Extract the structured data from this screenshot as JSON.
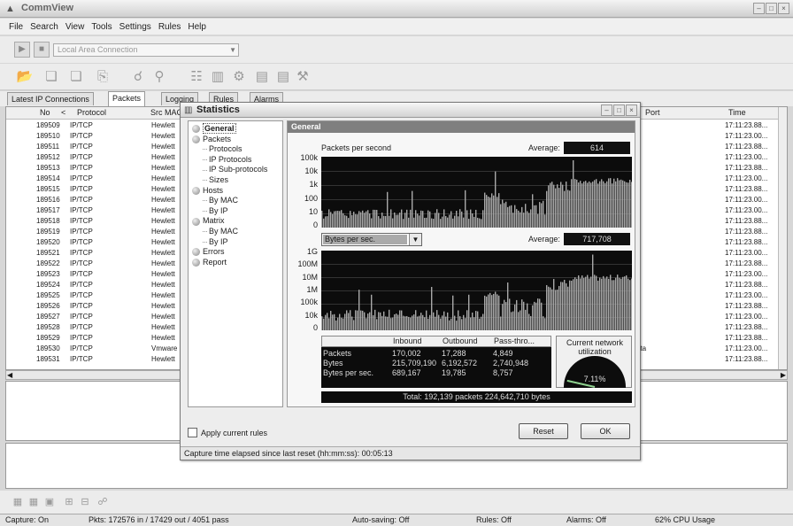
{
  "app": {
    "title": "CommView"
  },
  "menu": [
    "File",
    "Search",
    "View",
    "Tools",
    "Settings",
    "Rules",
    "Help"
  ],
  "adapter": {
    "value": "Local Area Connection"
  },
  "toolbar_icons": [
    "open-icon",
    "new-icon",
    "save-icon",
    "print-icon",
    "search-icon",
    "find-icon",
    "nodes-icon",
    "statistics-icon",
    "tools-icon",
    "monitor-icon",
    "monitor2-icon",
    "wrench-icon"
  ],
  "tabs": [
    {
      "label": "Latest IP Connections",
      "active": false
    },
    {
      "label": "Packets",
      "active": true
    },
    {
      "label": "Logging",
      "active": false
    },
    {
      "label": "Rules",
      "active": false
    },
    {
      "label": "Alarms",
      "active": false
    }
  ],
  "packets": {
    "columns": {
      "no": "No",
      "protocol": "Protocol",
      "src_mac": "Src MAC",
      "port": "Port",
      "time": "Time"
    },
    "rows": [
      {
        "no": "189509",
        "protocol": "IP/TCP",
        "src": "Hewlett",
        "port": "",
        "time": "17:11:23.88..."
      },
      {
        "no": "189510",
        "protocol": "IP/TCP",
        "src": "Hewlett",
        "port": "",
        "time": "17:11:23.00..."
      },
      {
        "no": "189511",
        "protocol": "IP/TCP",
        "src": "Hewlett",
        "port": "",
        "time": "17:11:23.88..."
      },
      {
        "no": "189512",
        "protocol": "IP/TCP",
        "src": "Hewlett",
        "port": "",
        "time": "17:11:23.00..."
      },
      {
        "no": "189513",
        "protocol": "IP/TCP",
        "src": "Hewlett",
        "port": "",
        "time": "17:11:23.88..."
      },
      {
        "no": "189514",
        "protocol": "IP/TCP",
        "src": "Hewlett",
        "port": "",
        "time": "17:11:23.00..."
      },
      {
        "no": "189515",
        "protocol": "IP/TCP",
        "src": "Hewlett",
        "port": "",
        "time": "17:11:23.88..."
      },
      {
        "no": "189516",
        "protocol": "IP/TCP",
        "src": "Hewlett",
        "port": "",
        "time": "17:11:23.00..."
      },
      {
        "no": "189517",
        "protocol": "IP/TCP",
        "src": "Hewlett",
        "port": "",
        "time": "17:11:23.00..."
      },
      {
        "no": "189518",
        "protocol": "IP/TCP",
        "src": "Hewlett",
        "port": "",
        "time": "17:11:23.88..."
      },
      {
        "no": "189519",
        "protocol": "IP/TCP",
        "src": "Hewlett",
        "port": "",
        "time": "17:11:23.88..."
      },
      {
        "no": "189520",
        "protocol": "IP/TCP",
        "src": "Hewlett",
        "port": "",
        "time": "17:11:23.88..."
      },
      {
        "no": "189521",
        "protocol": "IP/TCP",
        "src": "Hewlett",
        "port": "",
        "time": "17:11:23.00..."
      },
      {
        "no": "189522",
        "protocol": "IP/TCP",
        "src": "Hewlett",
        "port": "",
        "time": "17:11:23.88..."
      },
      {
        "no": "189523",
        "protocol": "IP/TCP",
        "src": "Hewlett",
        "port": "",
        "time": "17:11:23.00..."
      },
      {
        "no": "189524",
        "protocol": "IP/TCP",
        "src": "Hewlett",
        "port": "",
        "time": "17:11:23.88..."
      },
      {
        "no": "189525",
        "protocol": "IP/TCP",
        "src": "Hewlett",
        "port": "",
        "time": "17:11:23.00..."
      },
      {
        "no": "189526",
        "protocol": "IP/TCP",
        "src": "Hewlett",
        "port": "",
        "time": "17:11:23.88..."
      },
      {
        "no": "189527",
        "protocol": "IP/TCP",
        "src": "Hewlett",
        "port": "",
        "time": "17:11:23.00..."
      },
      {
        "no": "189528",
        "protocol": "IP/TCP",
        "src": "Hewlett",
        "port": "",
        "time": "17:11:23.88..."
      },
      {
        "no": "189529",
        "protocol": "IP/TCP",
        "src": "Hewlett",
        "port": "",
        "time": "17:11:23.88..."
      },
      {
        "no": "189530",
        "protocol": "IP/TCP",
        "src": "Vmware",
        "port": "ata",
        "time": "17:11:23.00..."
      },
      {
        "no": "189531",
        "protocol": "IP/TCP",
        "src": "Hewlett",
        "port": "",
        "time": "17:11:23.88..."
      }
    ]
  },
  "status": {
    "capture": "Capture: On",
    "pkts": "Pkts: 172576 in / 17429 out / 4051 pass",
    "autosave": "Auto-saving: Off",
    "rules": "Rules: Off",
    "alarms": "Alarms: Off",
    "cpu": "62% CPU Usage"
  },
  "statistics": {
    "title": "Statistics",
    "tree": [
      {
        "label": "General",
        "level": 0,
        "selected": true
      },
      {
        "label": "Packets",
        "level": 0
      },
      {
        "label": "Protocols",
        "level": 1
      },
      {
        "label": "IP Protocols",
        "level": 1
      },
      {
        "label": "IP Sub-protocols",
        "level": 1
      },
      {
        "label": "Sizes",
        "level": 1
      },
      {
        "label": "Hosts",
        "level": 0
      },
      {
        "label": "By MAC",
        "level": 1
      },
      {
        "label": "By IP",
        "level": 1
      },
      {
        "label": "Matrix",
        "level": 0
      },
      {
        "label": "By MAC",
        "level": 1
      },
      {
        "label": "By IP",
        "level": 1
      },
      {
        "label": "Errors",
        "level": 0
      },
      {
        "label": "Report",
        "level": 0
      }
    ],
    "panel_title": "General",
    "pps_label": "Packets per second",
    "average_label": "Average:",
    "pps_average": "614",
    "pps_ticks": [
      "100k",
      "10k",
      "1k",
      "100",
      "10",
      "0"
    ],
    "bytes_select": "Bytes per sec.",
    "bytes_average": "717,708",
    "bytes_ticks": [
      "1G",
      "100M",
      "10M",
      "1M",
      "100k",
      "10k",
      "0"
    ],
    "table_head": {
      "inbound": "Inbound",
      "outbound": "Outbound",
      "pass": "Pass-thro..."
    },
    "table_rows": [
      {
        "label": "Packets",
        "inbound": "170,002",
        "outbound": "17,288",
        "pass": "4,849"
      },
      {
        "label": "Bytes",
        "inbound": "215,709,190",
        "outbound": "6,192,572",
        "pass": "2,740,948"
      },
      {
        "label": "Bytes per sec.",
        "inbound": "689,167",
        "outbound": "19,785",
        "pass": "8,757"
      }
    ],
    "utilization_title": "Current network utilization",
    "utilization_value": "7.11%",
    "utilization_fraction": 0.0711,
    "total": "Total: 192,139 packets 224,642,710 bytes",
    "apply_rules": "Apply current rules",
    "reset_label": "Reset",
    "ok_label": "OK",
    "elapsed": "Capture time elapsed since last reset (hh:mm:ss): 00:05:13"
  }
}
